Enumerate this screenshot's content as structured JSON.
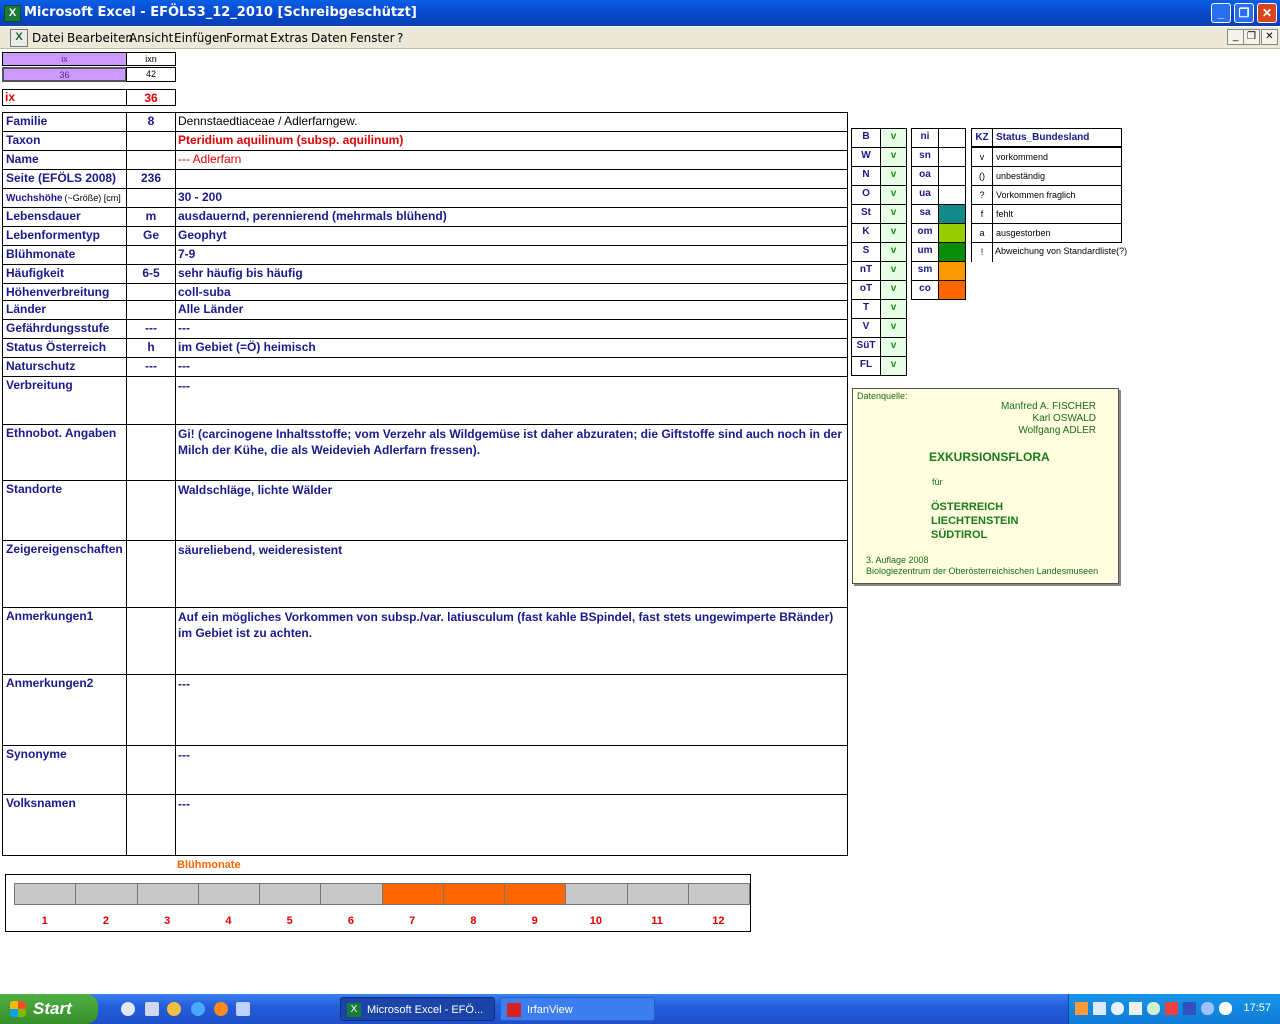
{
  "window": {
    "title": "Microsoft Excel - EFÖLS3_12_2010  [Schreibgeschützt]"
  },
  "menu": [
    "Datei",
    "Bearbeiten",
    "Ansicht",
    "Einfügen",
    "Format",
    "Extras",
    "Daten",
    "Fenster",
    "?"
  ],
  "nav": {
    "h1": "ix",
    "h2": "ixn",
    "v1": "36",
    "v2": "42"
  },
  "ix": {
    "label": "ix",
    "value": "36"
  },
  "rows": [
    {
      "label": "Familie",
      "code": "8",
      "value": "Dennstaedtiaceae  /  Adlerfarngew."
    },
    {
      "label": "Taxon",
      "code": "",
      "value": "Pteridium aquilinum (subsp. aquilinum)"
    },
    {
      "label": "Name",
      "code": "",
      "value": "--- Adlerfarn"
    },
    {
      "label": "Seite (EFÖLS 2008)",
      "code": "236",
      "value": ""
    },
    {
      "label": "Wuchshöhe",
      "label_small": "(~Größe) [cm]",
      "code": "",
      "value": "30 - 200"
    },
    {
      "label": "Lebensdauer",
      "code": "m",
      "value": "ausdauernd, perennierend (mehrmals blühend)"
    },
    {
      "label": "Lebenformentyp",
      "code": "Ge",
      "value": "Geophyt"
    },
    {
      "label": "Blühmonate",
      "code": "",
      "value": "7-9"
    },
    {
      "label": "Häufigkeit",
      "code": "6-5",
      "value": "sehr häufig bis häufig"
    },
    {
      "label": "Höhenverbreitung",
      "code": "",
      "value": "coll-suba"
    },
    {
      "label": "Länder",
      "code": "",
      "value": "Alle Länder"
    },
    {
      "label": "Gefährdungsstufe",
      "code": "---",
      "value": "---"
    },
    {
      "label": "Status Österreich",
      "code": "h",
      "value": "im Gebiet (=Ö) heimisch"
    },
    {
      "label": "Naturschutz",
      "code": "---",
      "value": "---"
    }
  ],
  "tall_rows": [
    {
      "label": "Verbreitung",
      "value": "---"
    },
    {
      "label": "Ethnobot. Angaben",
      "value": "Gi! (carcinogene Inhaltsstoffe; vom Verzehr als Wildgemüse ist daher abzuraten; die Giftstoffe sind auch noch in der Milch der Kühe, die als Weidevieh Adlerfarn fressen)."
    },
    {
      "label": "Standorte",
      "value": "Waldschläge, lichte Wälder"
    },
    {
      "label": "Zeigereigenschaften",
      "value": "säureliebend, weideresistent"
    },
    {
      "label": "Anmerkungen1",
      "value": "Auf ein mögliches Vorkommen von subsp./var. latiusculum (fast kahle BSpindel, fast stets ungewimperte BRänder) im Gebiet ist zu achten."
    },
    {
      "label": "Anmerkungen2",
      "value": "---"
    },
    {
      "label": "Synonyme",
      "value": "---"
    },
    {
      "label": "Volksnamen",
      "value": "---"
    }
  ],
  "regions": [
    {
      "k": "B",
      "v": "v"
    },
    {
      "k": "W",
      "v": "v"
    },
    {
      "k": "N",
      "v": "v"
    },
    {
      "k": "O",
      "v": "v"
    },
    {
      "k": "St",
      "v": "v"
    },
    {
      "k": "K",
      "v": "v"
    },
    {
      "k": "S",
      "v": "v"
    },
    {
      "k": "nT",
      "v": "v"
    },
    {
      "k": "oT",
      "v": "v"
    },
    {
      "k": "T",
      "v": "v"
    },
    {
      "k": "V",
      "v": "v"
    },
    {
      "k": "SüT",
      "v": "v"
    },
    {
      "k": "FL",
      "v": "v"
    }
  ],
  "altitude": [
    {
      "k": "ni",
      "color": ""
    },
    {
      "k": "sn",
      "color": ""
    },
    {
      "k": "oa",
      "color": ""
    },
    {
      "k": "ua",
      "color": ""
    },
    {
      "k": "sa",
      "color": "#138a8a"
    },
    {
      "k": "om",
      "color": "#99cc00"
    },
    {
      "k": "um",
      "color": "#0a8c0a"
    },
    {
      "k": "sm",
      "color": "#ff9900"
    },
    {
      "k": "co",
      "color": "#ff6600"
    }
  ],
  "status_legend": {
    "header_kz": "KZ",
    "header_title": "Status_Bundesland",
    "rows": [
      {
        "k": "v",
        "t": "vorkommend"
      },
      {
        "k": "()",
        "t": "unbeständig"
      },
      {
        "k": "?",
        "t": "Vorkommen fraglich"
      },
      {
        "k": "f",
        "t": "fehlt"
      },
      {
        "k": "a",
        "t": "ausgestorben"
      },
      {
        "k": "!",
        "t": "Abweichung von Standardliste(?)"
      }
    ]
  },
  "source": {
    "label": "Datenquelle:",
    "authors": [
      "Manfred A. FISCHER",
      "Karl OSWALD",
      "Wolfgang ADLER"
    ],
    "title": "EXKURSIONSFLORA",
    "fuer": "für",
    "countries": [
      "ÖSTERREICH",
      "LIECHTENSTEIN",
      "SÜDTIROL"
    ],
    "edition": "3. Auflage 2008",
    "publisher": "Biologiezentrum der Oberösterreichischen Landesmuseen"
  },
  "bloom": {
    "title": "Blühmonate",
    "months": [
      "1",
      "2",
      "3",
      "4",
      "5",
      "6",
      "7",
      "8",
      "9",
      "10",
      "11",
      "12"
    ],
    "active": [
      false,
      false,
      false,
      false,
      false,
      false,
      true,
      true,
      true,
      false,
      false,
      false
    ]
  },
  "taskbar": {
    "start": "Start",
    "tasks": [
      "Microsoft Excel - EFÖ...",
      "IrfanView"
    ],
    "clock": "17:57"
  },
  "colors": {
    "label_blue": "#1a1a8c",
    "red": "#e00000",
    "green": "#1a8c1a",
    "bloom_on": "#ff6600",
    "bloom_off": "#c8c8c8",
    "nav_purple": "#cc99ff"
  }
}
